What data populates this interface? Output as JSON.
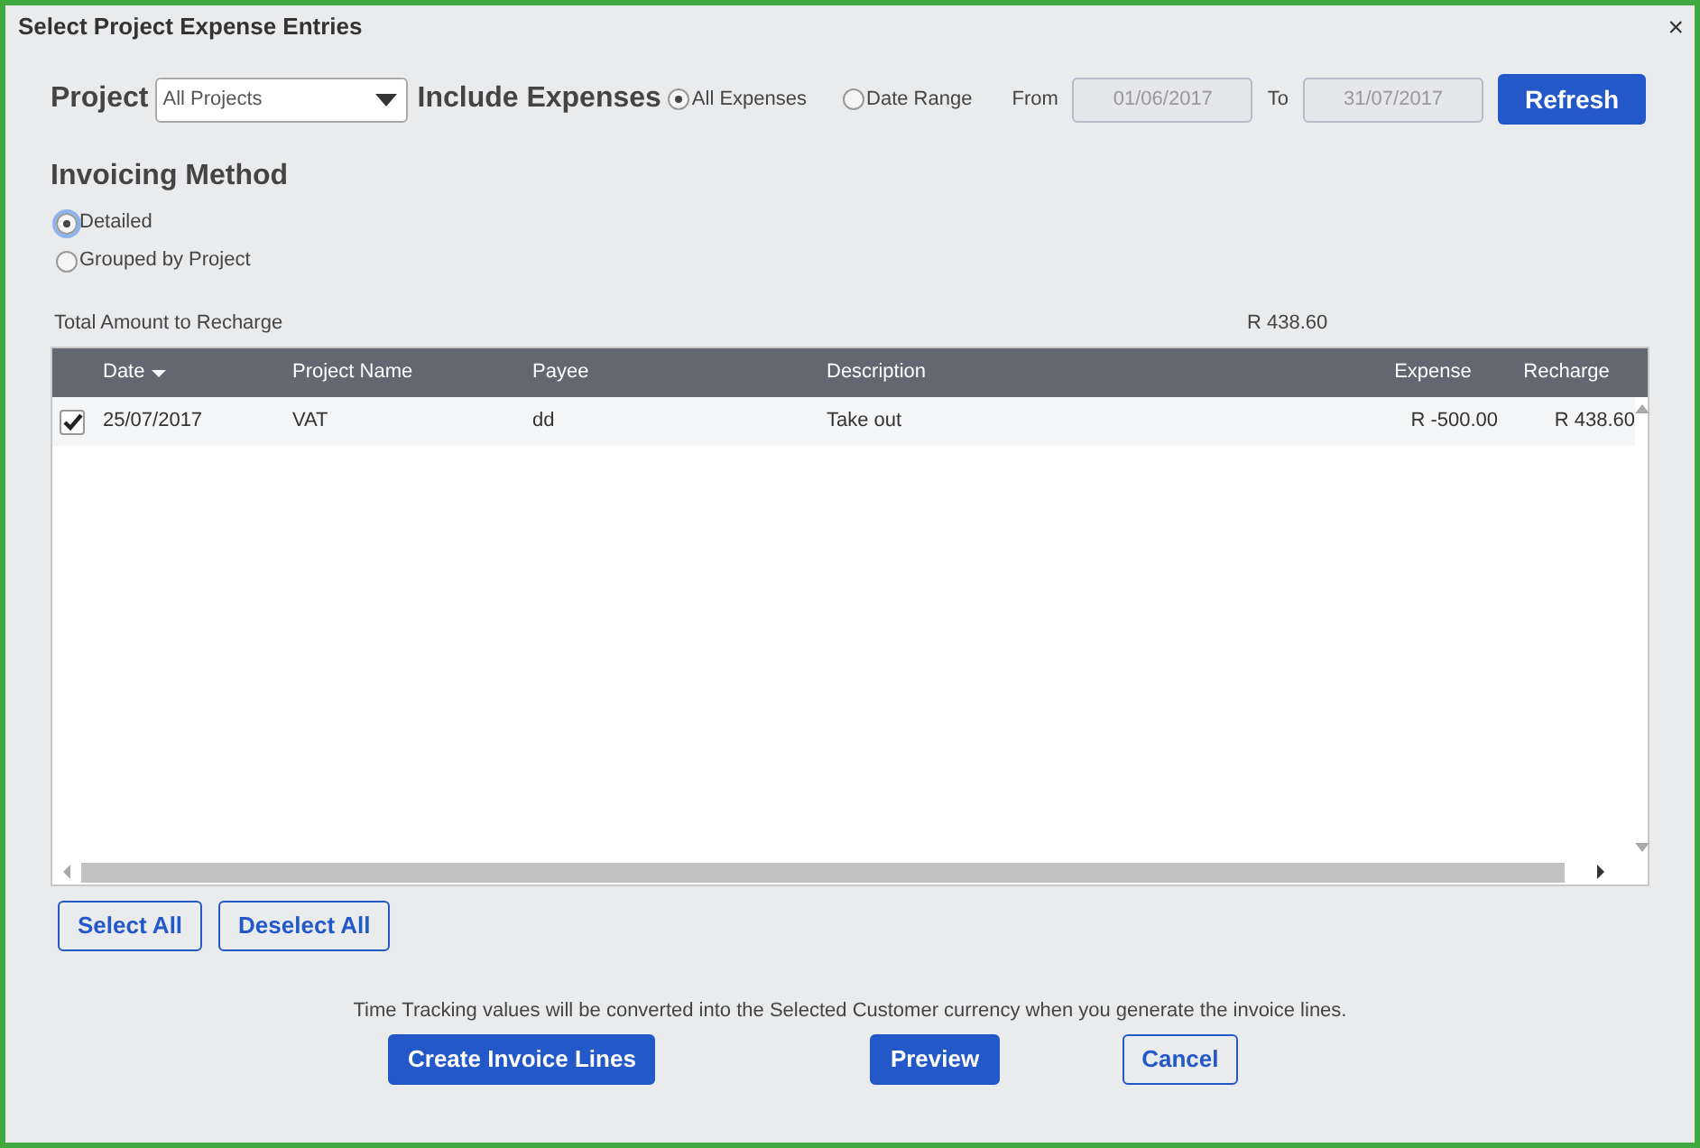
{
  "window": {
    "title": "Select Project Expense Entries",
    "close": "×"
  },
  "filters": {
    "project_label": "Project",
    "project_value": "All Projects",
    "include_label": "Include Expenses",
    "include_options": [
      {
        "label": "All Expenses",
        "selected": true
      },
      {
        "label": "Date Range",
        "selected": false
      }
    ],
    "from_label": "From",
    "from_value": "01/06/2017",
    "to_label": "To",
    "to_value": "31/07/2017",
    "dates_disabled": true,
    "refresh": "Refresh"
  },
  "invoicing": {
    "heading": "Invoicing Method",
    "options": [
      {
        "label": "Detailed",
        "selected": true
      },
      {
        "label": "Grouped by Project",
        "selected": false
      }
    ]
  },
  "total": {
    "label": "Total Amount to Recharge",
    "value": "R 438.60"
  },
  "table": {
    "columns": [
      {
        "label": "Date",
        "sorted": true
      },
      {
        "label": "Project Name",
        "sorted": false
      },
      {
        "label": "Payee",
        "sorted": false
      },
      {
        "label": "Description",
        "sorted": false
      },
      {
        "label": "Expense",
        "sorted": false
      },
      {
        "label": "Recharge",
        "sorted": false
      }
    ],
    "rows": [
      {
        "checked": true,
        "cells": [
          "25/07/2017",
          "VAT",
          "dd",
          "Take out",
          "R -500.00",
          "R 438.60"
        ]
      }
    ]
  },
  "selection_buttons": [
    "Select All",
    "Deselect All"
  ],
  "note": "Time Tracking values will be converted into the Selected Customer currency when you generate the invoice lines.",
  "actions": [
    {
      "label": "Create Invoice Lines",
      "kind": "primary"
    },
    {
      "label": "Preview",
      "kind": "primary"
    },
    {
      "label": "Cancel",
      "kind": "secondary"
    }
  ]
}
